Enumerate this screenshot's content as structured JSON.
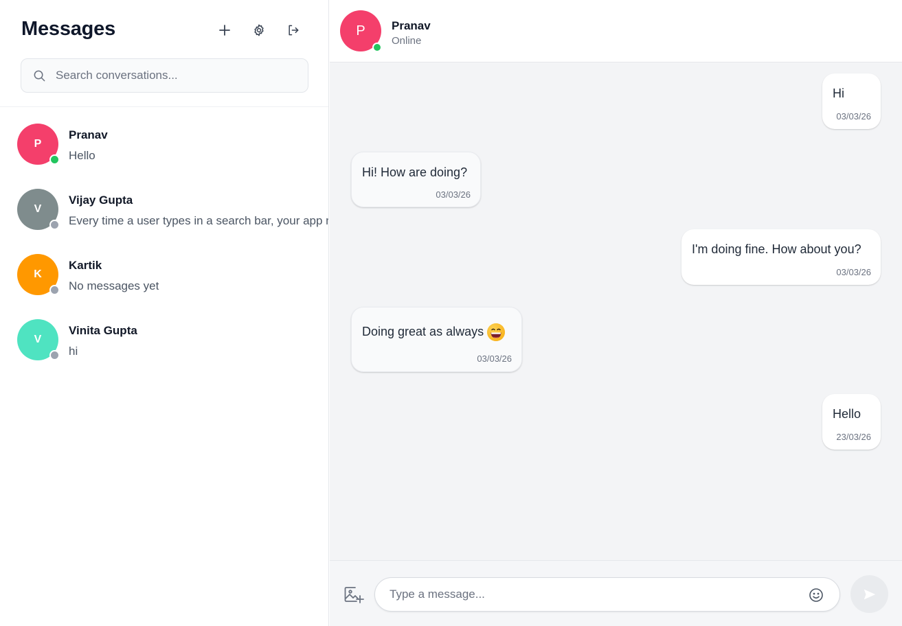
{
  "sidebar": {
    "title": "Messages",
    "actions": [
      {
        "name": "new-chat-button",
        "icon": "plus-icon"
      },
      {
        "name": "settings-button",
        "icon": "gear-icon"
      },
      {
        "name": "logout-button",
        "icon": "logout-icon"
      }
    ],
    "search": {
      "placeholder": "Search conversations...",
      "value": ""
    },
    "conversations": [
      {
        "initial": "P",
        "name": "Pranav",
        "preview": "Hello",
        "avatar_color": "#f43f6b",
        "status": "online",
        "status_color": "#22c55e"
      },
      {
        "initial": "V",
        "name": "Vijay Gupta",
        "preview": "Every time a user types in a search bar, your app might trigger",
        "avatar_color": "#7f8c8d",
        "status": "offline",
        "status_color": "#9ca3af"
      },
      {
        "initial": "K",
        "name": "Kartik",
        "preview": "No messages yet",
        "avatar_color": "#ff9800",
        "status": "offline",
        "status_color": "#9ca3af"
      },
      {
        "initial": "V",
        "name": "Vinita Gupta",
        "preview": "hi",
        "avatar_color": "#4fe3c1",
        "status": "offline",
        "status_color": "#9ca3af"
      }
    ]
  },
  "chat": {
    "contact": {
      "initial": "P",
      "name": "Pranav",
      "status": "Online",
      "avatar_color": "#f43f6b",
      "status_color": "#22c55e"
    },
    "messages": [
      {
        "direction": "out",
        "text": "Hi",
        "time": "03/03/26"
      },
      {
        "direction": "in",
        "text": "Hi! How are doing?",
        "time": "03/03/26"
      },
      {
        "direction": "out",
        "text": "I'm doing fine. How about you?",
        "time": "03/03/26"
      },
      {
        "direction": "in",
        "text": "Doing great as always",
        "emoji": "grinning-face-emoji",
        "time": "03/03/26"
      },
      {
        "direction": "out",
        "text": "Hello",
        "time": "23/03/26"
      }
    ],
    "composer": {
      "placeholder": "Type a message...",
      "value": ""
    }
  }
}
